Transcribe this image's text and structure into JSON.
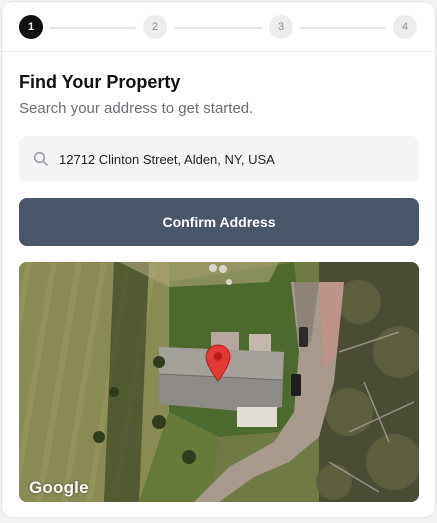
{
  "stepper": {
    "steps": [
      {
        "label": "1",
        "state": "active"
      },
      {
        "label": "2",
        "state": "inactive"
      },
      {
        "label": "3",
        "state": "inactive"
      },
      {
        "label": "4",
        "state": "inactive"
      }
    ]
  },
  "header": {
    "title": "Find Your Property",
    "subtitle": "Search your address to get started."
  },
  "search": {
    "value": "12712 Clinton Street, Alden, NY, USA",
    "icon": "search-icon"
  },
  "confirm_button": {
    "label": "Confirm Address",
    "color": "#4a5669"
  },
  "map": {
    "attribution": "Google",
    "marker_color": "#e53935"
  }
}
